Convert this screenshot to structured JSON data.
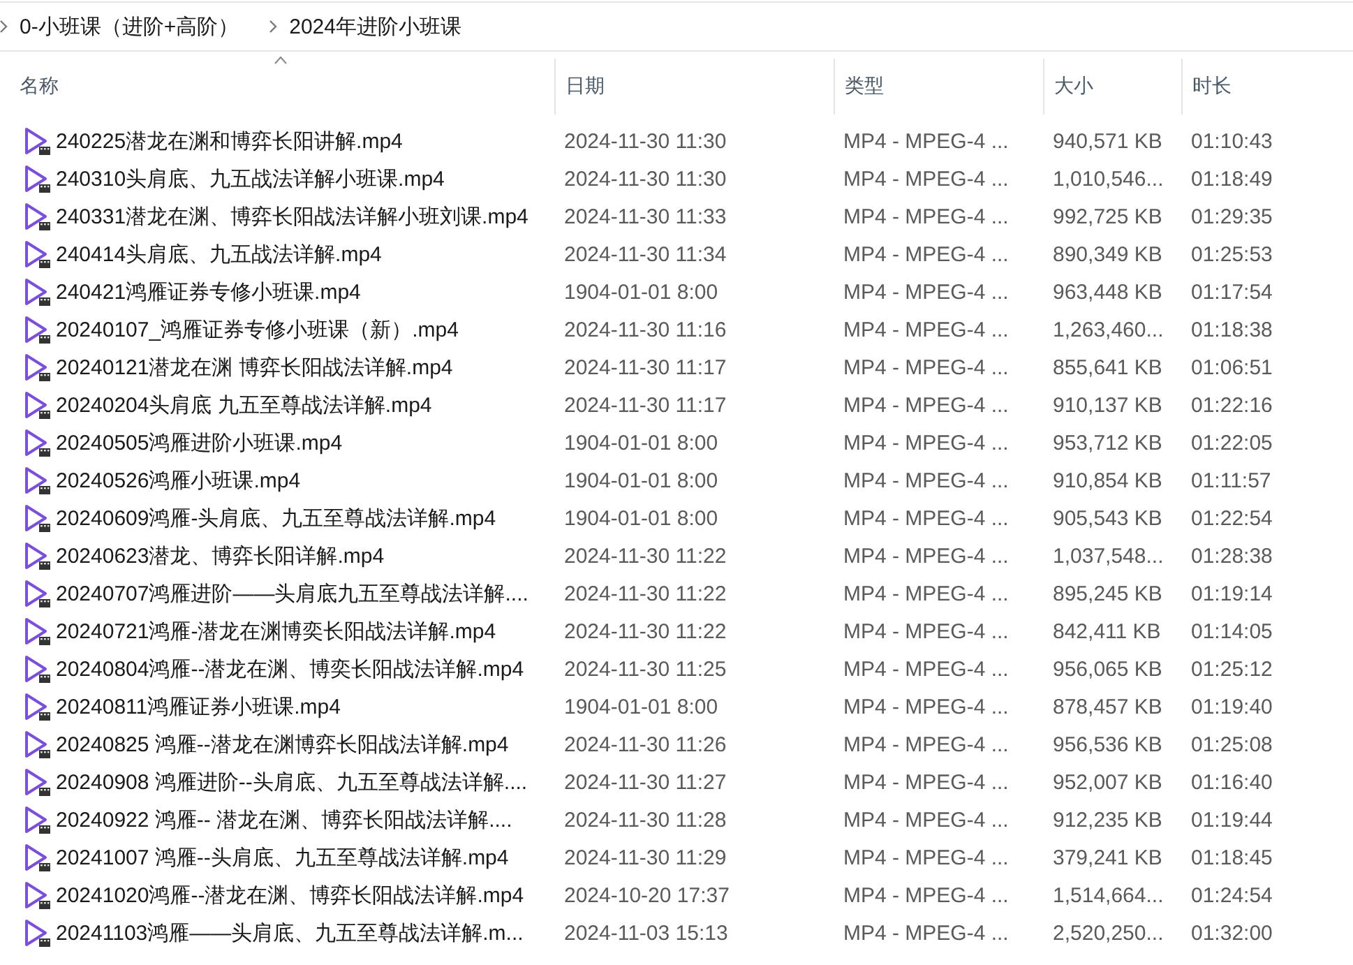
{
  "breadcrumb": [
    "0-小班课（进阶+高阶）",
    "2024年进阶小班课"
  ],
  "table": {
    "columns": [
      "名称",
      "日期",
      "类型",
      "大小",
      "时长"
    ],
    "rows": [
      {
        "name": "240225潜龙在渊和博弈长阳讲解.mp4",
        "date": "2024-11-30 11:30",
        "type": "MP4 - MPEG-4 ...",
        "size": "940,571 KB",
        "duration": "01:10:43"
      },
      {
        "name": "240310头肩底、九五战法详解小班课.mp4",
        "date": "2024-11-30 11:30",
        "type": "MP4 - MPEG-4 ...",
        "size": "1,010,546...",
        "duration": "01:18:49"
      },
      {
        "name": "240331潜龙在渊、博弈长阳战法详解小班刘课.mp4",
        "date": "2024-11-30 11:33",
        "type": "MP4 - MPEG-4 ...",
        "size": "992,725 KB",
        "duration": "01:29:35"
      },
      {
        "name": "240414头肩底、九五战法详解.mp4",
        "date": "2024-11-30 11:34",
        "type": "MP4 - MPEG-4 ...",
        "size": "890,349 KB",
        "duration": "01:25:53"
      },
      {
        "name": "240421鸿雁证券专修小班课.mp4",
        "date": "1904-01-01 8:00",
        "type": "MP4 - MPEG-4 ...",
        "size": "963,448 KB",
        "duration": "01:17:54"
      },
      {
        "name": "20240107_鸿雁证券专修小班课（新）.mp4",
        "date": "2024-11-30 11:16",
        "type": "MP4 - MPEG-4 ...",
        "size": "1,263,460...",
        "duration": "01:18:38"
      },
      {
        "name": "20240121潜龙在渊 博弈长阳战法详解.mp4",
        "date": "2024-11-30 11:17",
        "type": "MP4 - MPEG-4 ...",
        "size": "855,641 KB",
        "duration": "01:06:51"
      },
      {
        "name": "20240204头肩底 九五至尊战法详解.mp4",
        "date": "2024-11-30 11:17",
        "type": "MP4 - MPEG-4 ...",
        "size": "910,137 KB",
        "duration": "01:22:16"
      },
      {
        "name": "20240505鸿雁进阶小班课.mp4",
        "date": "1904-01-01 8:00",
        "type": "MP4 - MPEG-4 ...",
        "size": "953,712 KB",
        "duration": "01:22:05"
      },
      {
        "name": "20240526鸿雁小班课.mp4",
        "date": "1904-01-01 8:00",
        "type": "MP4 - MPEG-4 ...",
        "size": "910,854 KB",
        "duration": "01:11:57"
      },
      {
        "name": "20240609鸿雁-头肩底、九五至尊战法详解.mp4",
        "date": "1904-01-01 8:00",
        "type": "MP4 - MPEG-4 ...",
        "size": "905,543 KB",
        "duration": "01:22:54"
      },
      {
        "name": "20240623潜龙、博弈长阳详解.mp4",
        "date": "2024-11-30 11:22",
        "type": "MP4 - MPEG-4 ...",
        "size": "1,037,548...",
        "duration": "01:28:38"
      },
      {
        "name": "20240707鸿雁进阶——头肩底九五至尊战法详解....",
        "date": "2024-11-30 11:22",
        "type": "MP4 - MPEG-4 ...",
        "size": "895,245 KB",
        "duration": "01:19:14"
      },
      {
        "name": "20240721鸿雁-潜龙在渊博奕长阳战法详解.mp4",
        "date": "2024-11-30 11:22",
        "type": "MP4 - MPEG-4 ...",
        "size": "842,411 KB",
        "duration": "01:14:05"
      },
      {
        "name": "20240804鸿雁--潜龙在渊、博奕长阳战法详解.mp4",
        "date": "2024-11-30 11:25",
        "type": "MP4 - MPEG-4 ...",
        "size": "956,065 KB",
        "duration": "01:25:12"
      },
      {
        "name": "20240811鸿雁证券小班课.mp4",
        "date": "1904-01-01 8:00",
        "type": "MP4 - MPEG-4 ...",
        "size": "878,457 KB",
        "duration": "01:19:40"
      },
      {
        "name": "20240825 鸿雁--潜龙在渊博弈长阳战法详解.mp4",
        "date": "2024-11-30 11:26",
        "type": "MP4 - MPEG-4 ...",
        "size": "956,536 KB",
        "duration": "01:25:08"
      },
      {
        "name": "20240908 鸿雁进阶--头肩底、九五至尊战法详解....",
        "date": "2024-11-30 11:27",
        "type": "MP4 - MPEG-4 ...",
        "size": "952,007 KB",
        "duration": "01:16:40"
      },
      {
        "name": "20240922 鸿雁-- 潜龙在渊、博弈长阳战法详解....",
        "date": "2024-11-30 11:28",
        "type": "MP4 - MPEG-4 ...",
        "size": "912,235 KB",
        "duration": "01:19:44"
      },
      {
        "name": "20241007 鸿雁--头肩底、九五至尊战法详解.mp4",
        "date": "2024-11-30 11:29",
        "type": "MP4 - MPEG-4 ...",
        "size": "379,241 KB",
        "duration": "01:18:45"
      },
      {
        "name": "20241020鸿雁--潜龙在渊、博弈长阳战法详解.mp4",
        "date": "2024-10-20 17:37",
        "type": "MP4 - MPEG-4 ...",
        "size": "1,514,664...",
        "duration": "01:24:54"
      },
      {
        "name": "20241103鸿雁——头肩底、九五至尊战法详解.m...",
        "date": "2024-11-03 15:13",
        "type": "MP4 - MPEG-4 ...",
        "size": "2,520,250...",
        "duration": "01:32:00"
      }
    ]
  }
}
